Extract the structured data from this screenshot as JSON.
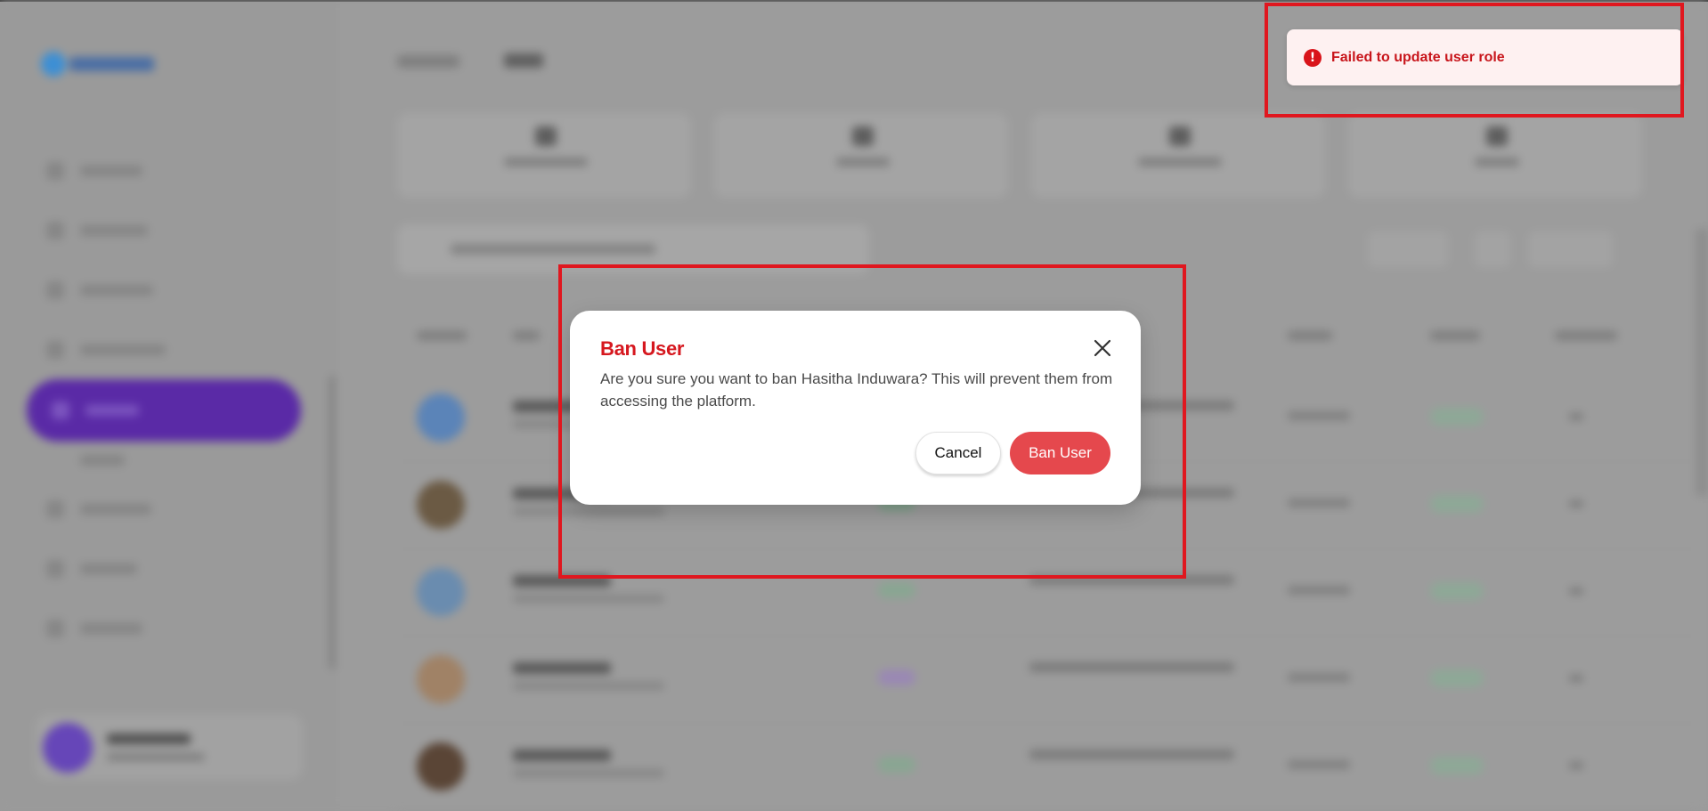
{
  "toast": {
    "icon": "error-icon",
    "message": "Failed to update user role",
    "color": "#c8151b"
  },
  "modal": {
    "title": "Ban User",
    "body": "Are you sure you want to ban Hasitha Induwara? This will prevent them from accessing the platform.",
    "cancel_label": "Cancel",
    "confirm_label": "Ban User",
    "confirm_color": "#e5484d",
    "title_color": "#d6181f"
  },
  "background": {
    "accent_color": "#5a2aa6",
    "overlay": "dimmed"
  }
}
